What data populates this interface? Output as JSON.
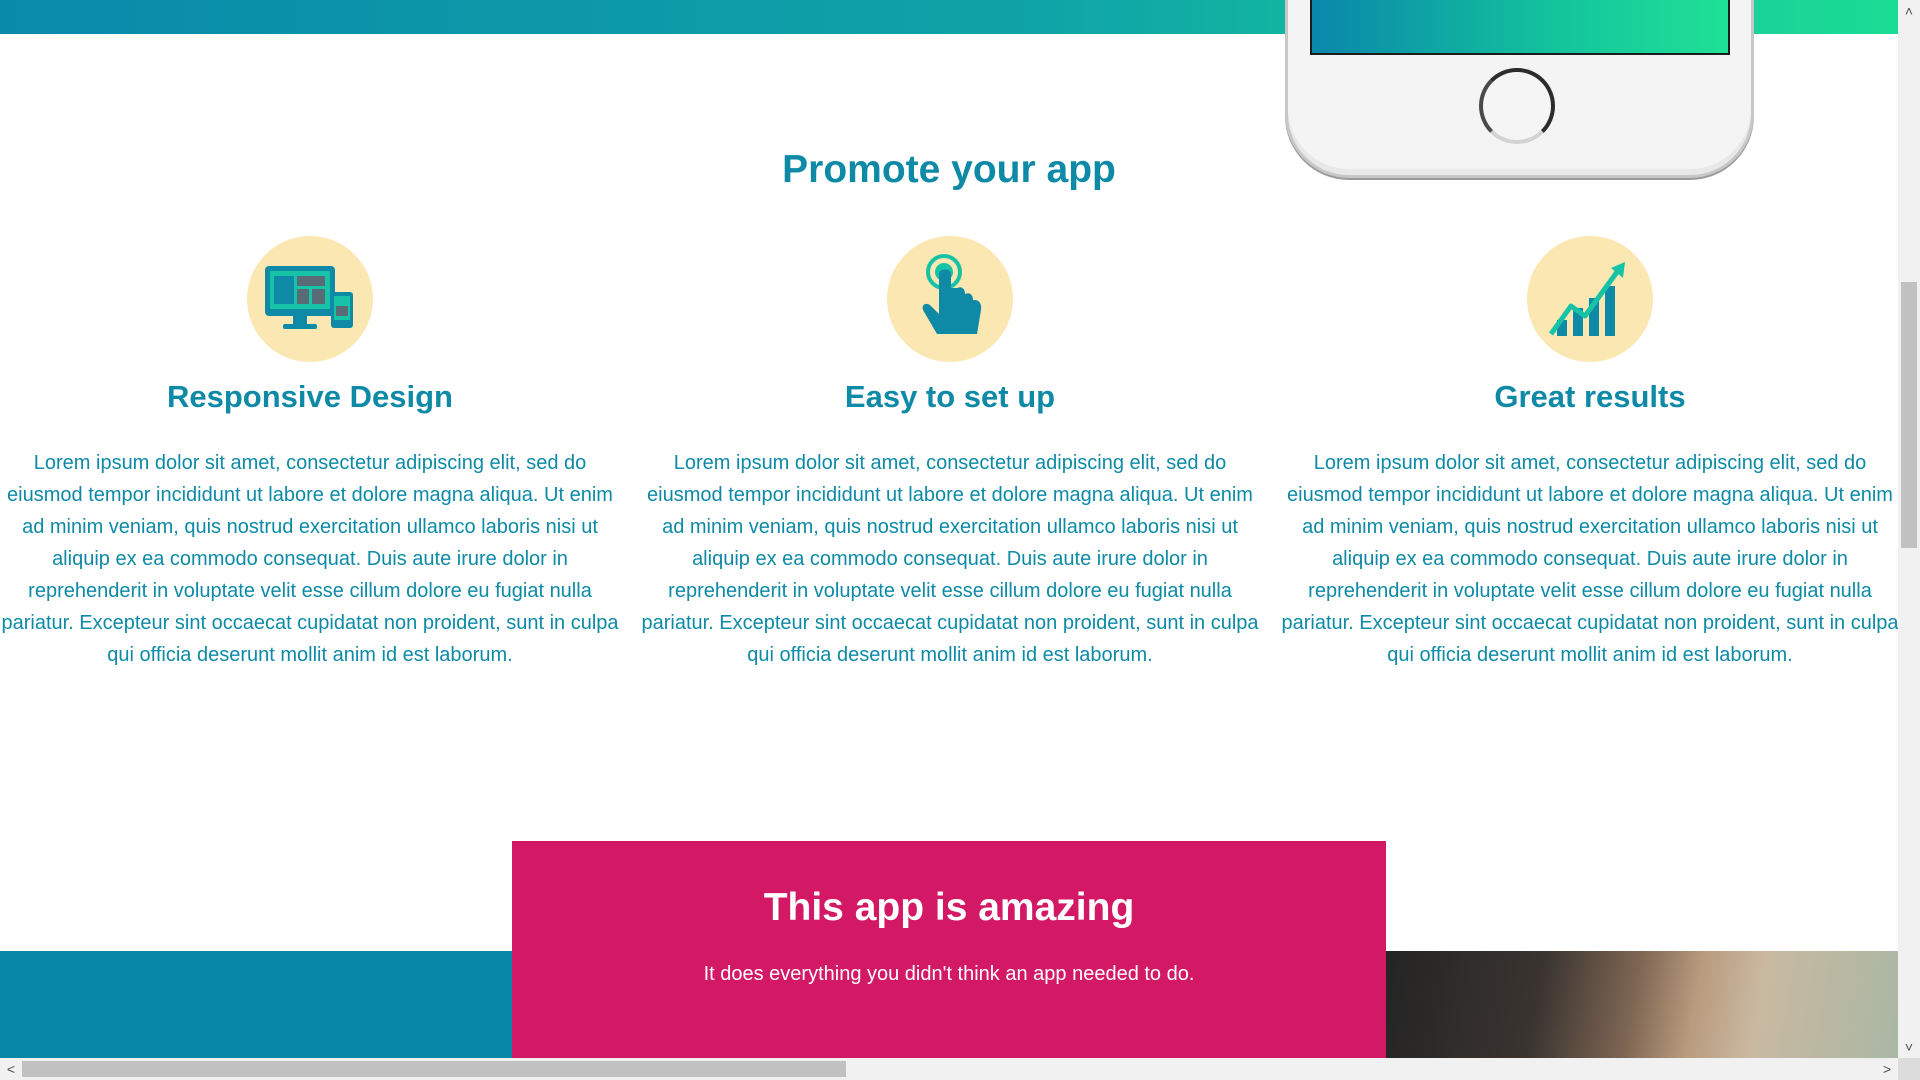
{
  "section": {
    "title": "Promote your app"
  },
  "features": [
    {
      "icon": "responsive-devices-icon",
      "title": "Responsive Design",
      "text": "Lorem ipsum dolor sit amet, consectetur adipiscing elit, sed do eiusmod tempor incididunt ut labore et dolore magna aliqua. Ut enim ad minim veniam, quis nostrud exercitation ullamco laboris nisi ut aliquip ex ea commodo consequat. Duis aute irure dolor in reprehenderit in voluptate velit esse cillum dolore eu fugiat nulla pariatur. Excepteur sint occaecat cupidatat non proident, sunt in culpa qui officia deserunt mollit anim id est laborum."
    },
    {
      "icon": "tap-hand-icon",
      "title": "Easy to set up",
      "text": "Lorem ipsum dolor sit amet, consectetur adipiscing elit, sed do eiusmod tempor incididunt ut labore et dolore magna aliqua. Ut enim ad minim veniam, quis nostrud exercitation ullamco laboris nisi ut aliquip ex ea commodo consequat. Duis aute irure dolor in reprehenderit in voluptate velit esse cillum dolore eu fugiat nulla pariatur. Excepteur sint occaecat cupidatat non proident, sunt in culpa qui officia deserunt mollit anim id est laborum."
    },
    {
      "icon": "growth-chart-icon",
      "title": "Great results",
      "text": "Lorem ipsum dolor sit amet, consectetur adipiscing elit, sed do eiusmod tempor incididunt ut labore et dolore magna aliqua. Ut enim ad minim veniam, quis nostrud exercitation ullamco laboris nisi ut aliquip ex ea commodo consequat. Duis aute irure dolor in reprehenderit in voluptate velit esse cillum dolore eu fugiat nulla pariatur. Excepteur sint occaecat cupidatat non proident, sunt in culpa qui officia deserunt mollit anim id est laborum."
    }
  ],
  "cta": {
    "title": "This app is amazing",
    "text": "It does everything you didn't think an app needed to do."
  },
  "colors": {
    "accent": "#0e8aa7",
    "icon_bg": "#fbe7b1",
    "cta_bg": "#d31865",
    "gradient_start": "#0a8aaa",
    "gradient_end": "#1bdc95"
  },
  "scrollbars": {
    "left_arrow": "<",
    "right_arrow": ">",
    "up_arrow": "˄",
    "down_arrow": "˅"
  }
}
